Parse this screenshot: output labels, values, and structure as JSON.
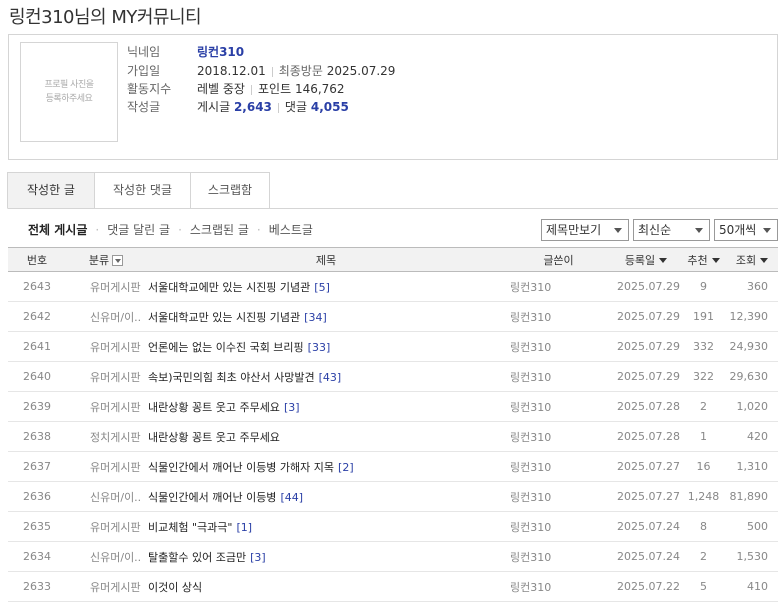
{
  "page_title": "링컨310님의 MY커뮤니티",
  "profile": {
    "photo_placeholder_line1": "프로필 사진을",
    "photo_placeholder_line2": "등록하주세요",
    "nickname_label": "닉네임",
    "nickname": "링컨310",
    "joined_label": "가입일",
    "joined": "2018.12.01",
    "last_visit_label": "최종방문",
    "last_visit": "2025.07.29",
    "activity_label": "활동지수",
    "level": "레벨 중장",
    "points_label": "포인트",
    "points": "146,762",
    "posts_label": "작성글",
    "post_count_label": "게시글",
    "post_count": "2,643",
    "comment_count_label": "댓글",
    "comment_count": "4,055"
  },
  "tabs": [
    "작성한 글",
    "작성한 댓글",
    "스크랩함"
  ],
  "subnav": [
    "전체 게시글",
    "댓글 달린 글",
    "스크랩된 글",
    "베스트글"
  ],
  "filters": {
    "view_mode": "제목만보기",
    "sort": "최신순",
    "per_page": "50개씩"
  },
  "columns": {
    "no": "번호",
    "category": "분류",
    "title": "제목",
    "author": "글쓴이",
    "date": "등록일",
    "recommend": "추천",
    "views": "조회"
  },
  "posts": [
    {
      "no": "2643",
      "category": "유머게시판",
      "title": "서울대학교에만 있는 시진핑 기념관",
      "comments": "[5]",
      "author": "링컨310",
      "date": "2025.07.29",
      "recommend": "9",
      "views": "360"
    },
    {
      "no": "2642",
      "category": "신유머/이..",
      "title": "서울대학교만 있는 시진핑 기념관",
      "comments": "[34]",
      "author": "링컨310",
      "date": "2025.07.29",
      "recommend": "191",
      "views": "12,390"
    },
    {
      "no": "2641",
      "category": "유머게시판",
      "title": "언론에는 없는 이수진 국회 브리핑",
      "comments": "[33]",
      "author": "링컨310",
      "date": "2025.07.29",
      "recommend": "332",
      "views": "24,930"
    },
    {
      "no": "2640",
      "category": "유머게시판",
      "title": "속보)국민의힘 최초 야산서 사망발견",
      "comments": "[43]",
      "author": "링컨310",
      "date": "2025.07.29",
      "recommend": "322",
      "views": "29,630"
    },
    {
      "no": "2639",
      "category": "유머게시판",
      "title": "내란상황 꽁트 웃고 주무세요",
      "comments": "[3]",
      "author": "링컨310",
      "date": "2025.07.28",
      "recommend": "2",
      "views": "1,020"
    },
    {
      "no": "2638",
      "category": "정치게시판",
      "title": "내란상황 꽁트 웃고 주무세요",
      "comments": "",
      "author": "링컨310",
      "date": "2025.07.28",
      "recommend": "1",
      "views": "420"
    },
    {
      "no": "2637",
      "category": "유머게시판",
      "title": "식물인간에서 깨어난 이등병 가해자 지목",
      "comments": "[2]",
      "author": "링컨310",
      "date": "2025.07.27",
      "recommend": "16",
      "views": "1,310"
    },
    {
      "no": "2636",
      "category": "신유머/이..",
      "title": "식물인간에서 깨어난 이등병",
      "comments": "[44]",
      "author": "링컨310",
      "date": "2025.07.27",
      "recommend": "1,248",
      "views": "81,890"
    },
    {
      "no": "2635",
      "category": "유머게시판",
      "title": "비교체험 \"극과극\"",
      "comments": "[1]",
      "author": "링컨310",
      "date": "2025.07.24",
      "recommend": "8",
      "views": "500"
    },
    {
      "no": "2634",
      "category": "신유머/이..",
      "title": "탈출할수 있어 조금만",
      "comments": "[3]",
      "author": "링컨310",
      "date": "2025.07.24",
      "recommend": "2",
      "views": "1,530"
    },
    {
      "no": "2633",
      "category": "유머게시판",
      "title": "이것이 상식",
      "comments": "",
      "author": "링컨310",
      "date": "2025.07.22",
      "recommend": "5",
      "views": "410"
    }
  ]
}
